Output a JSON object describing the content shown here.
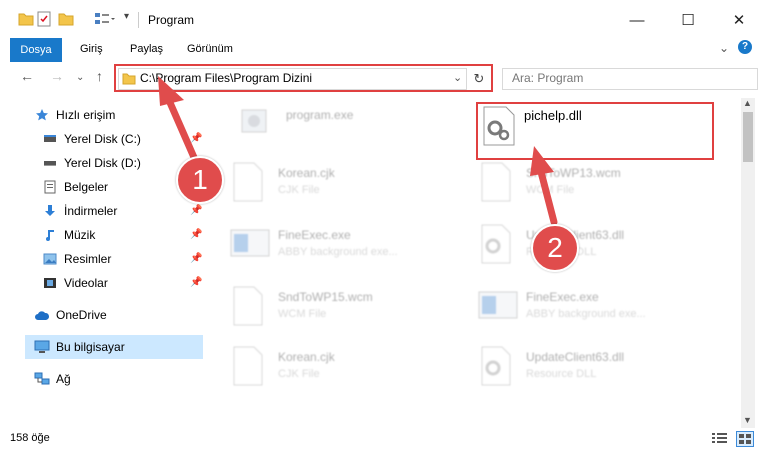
{
  "window": {
    "title": "Program"
  },
  "ribbon": {
    "tabs": [
      {
        "label": "Dosya"
      },
      {
        "label": "Giriş"
      },
      {
        "label": "Paylaş"
      },
      {
        "label": "Görünüm"
      }
    ]
  },
  "address": {
    "path": "C:\\Program Files\\Program Dizini"
  },
  "search": {
    "placeholder": "Ara: Program"
  },
  "sidebar": {
    "quick_access": "Hızlı erişim",
    "items": [
      {
        "label": "Yerel Disk (C:)"
      },
      {
        "label": "Yerel Disk (D:)"
      },
      {
        "label": "Belgeler"
      },
      {
        "label": "İndirmeler"
      },
      {
        "label": "Müzik"
      },
      {
        "label": "Resimler"
      },
      {
        "label": "Videolar"
      }
    ],
    "onedrive": "OneDrive",
    "this_pc": "Bu bilgisayar",
    "network": "Ağ"
  },
  "files": [
    {
      "name": "program.exe",
      "type": ""
    },
    {
      "name": "pichelp.dll",
      "type": ""
    },
    {
      "name": "Korean.cjk",
      "type": "CJK File"
    },
    {
      "name": "SndToWP13.wcm",
      "type": "WCM File"
    },
    {
      "name": "FineExec.exe",
      "type": "ABBY background exe..."
    },
    {
      "name": "UpdateClient63.dll",
      "type": "Resource DLL"
    },
    {
      "name": "SndToWP15.wcm",
      "type": "WCM File"
    },
    {
      "name": "FineExec.exe",
      "type": "ABBY background exe..."
    },
    {
      "name": "Korean.cjk",
      "type": "CJK File"
    },
    {
      "name": "UpdateClient63.dll",
      "type": "Resource DLL"
    }
  ],
  "status": {
    "count": "158 öğe"
  },
  "annotations": {
    "step1": "1",
    "step2": "2"
  },
  "colors": {
    "accent": "#1979ca",
    "highlight": "#e04040",
    "selected": "#cce8ff"
  }
}
